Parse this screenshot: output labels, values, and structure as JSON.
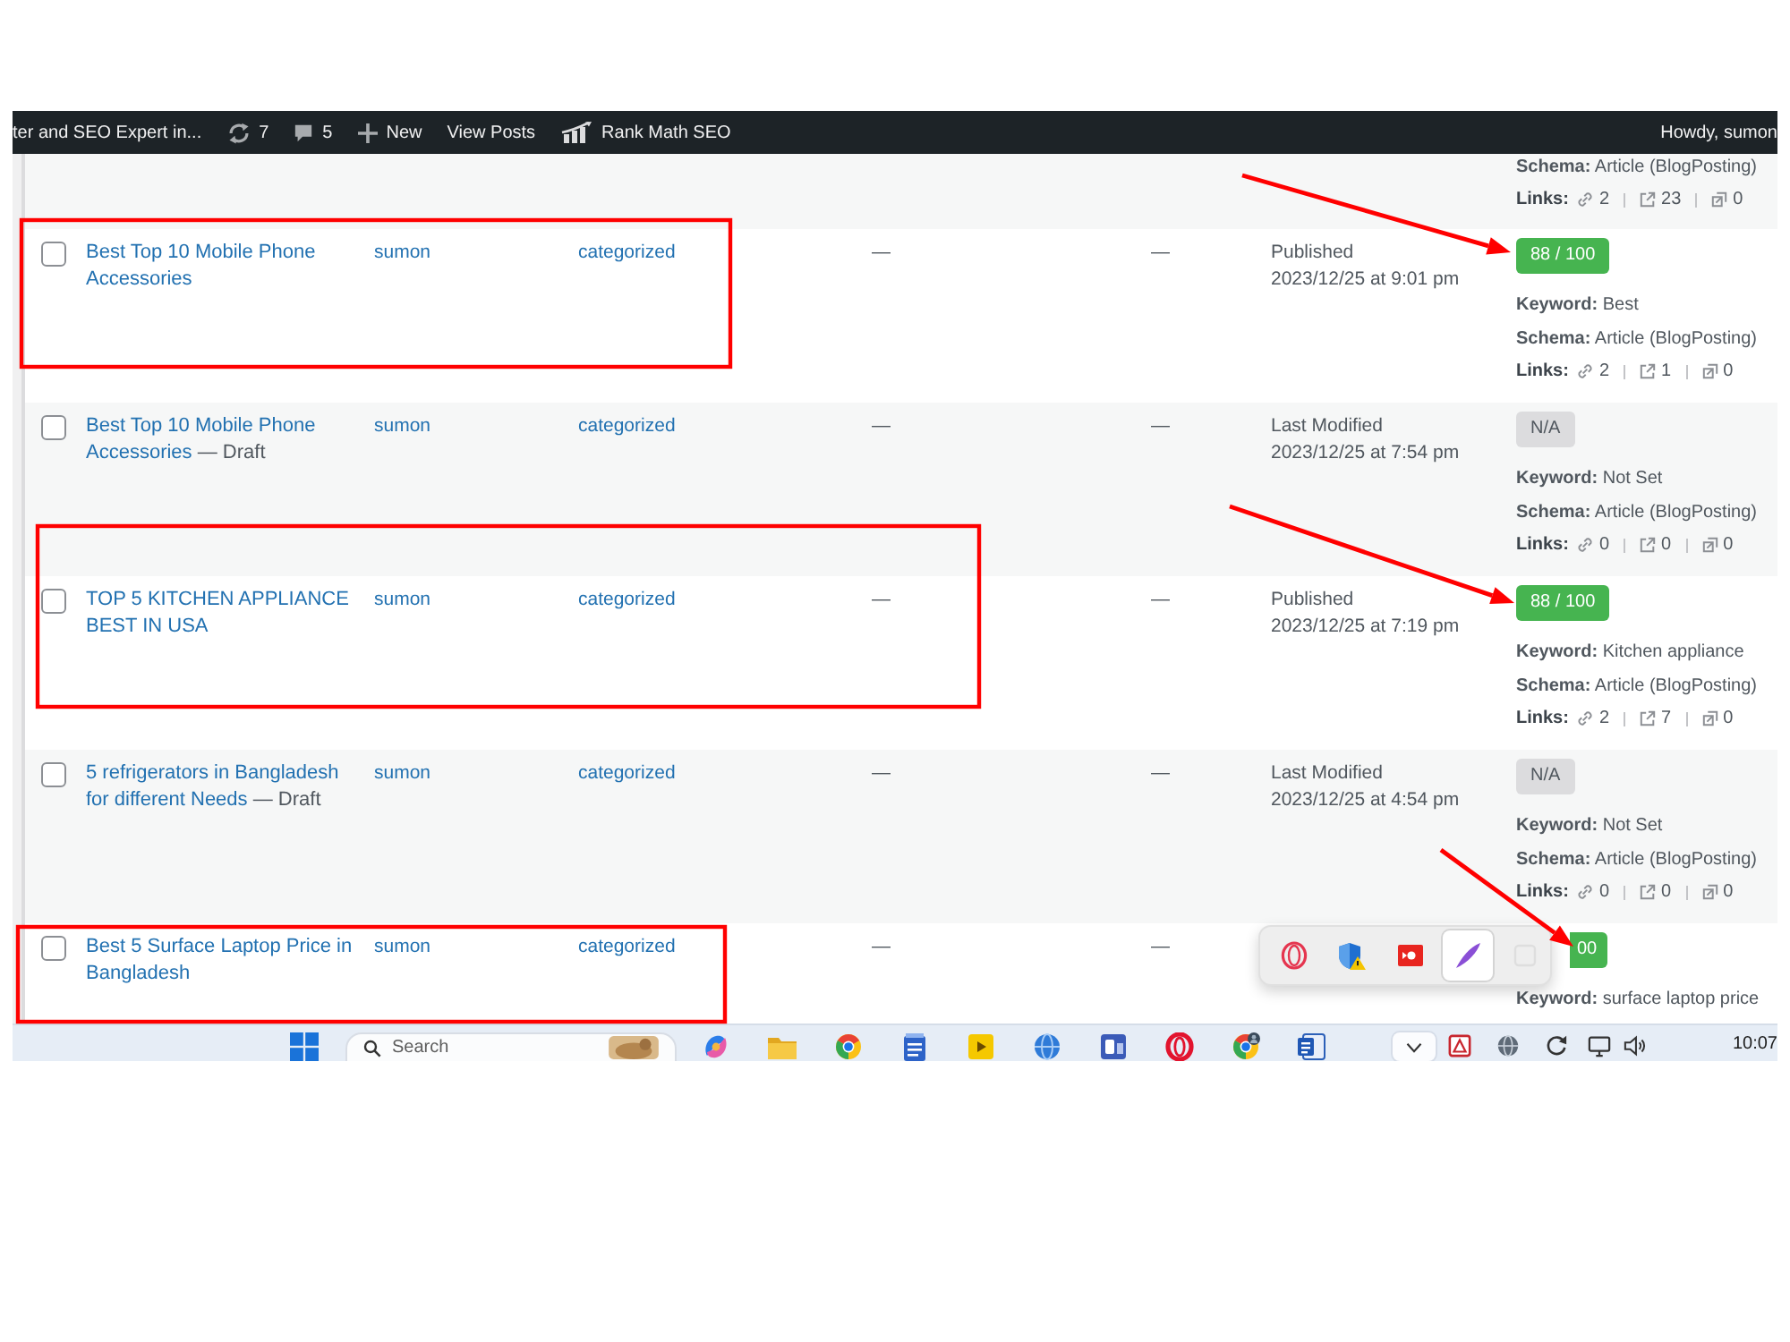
{
  "admin_bar": [
    {
      "kind": "site",
      "label": "ter and SEO Expert in..."
    },
    {
      "kind": "updates",
      "label": "7"
    },
    {
      "kind": "comments",
      "label": "5"
    },
    {
      "kind": "new",
      "label": "New"
    },
    {
      "kind": "link",
      "label": "View Posts"
    },
    {
      "kind": "seo",
      "label": "Rank Math SEO"
    },
    {
      "kind": "account",
      "label": "Howdy, sumon"
    }
  ],
  "previous_row_tail": {
    "schema": "**Schema:** Article (BlogPosting)",
    "links_label": "Links:",
    "links": [
      "2",
      "23",
      "0"
    ]
  },
  "rows": [
    {
      "checked": false,
      "title": "Best Top 10 Mobile Phone Accessories",
      "column_2": "sumon",
      "column_3": "categorized",
      "column_4": "—",
      "column_5": "—",
      "status": "Published",
      "date": "2023/12/25 at 9:01 pm",
      "score": {
        "kind": "good",
        "text": "88 / 100",
        "covered": false
      },
      "keyword": "**Keyword:** Best",
      "schema": "**Schema:** Article (BlogPosting)",
      "links_label": "Links:",
      "links": [
        "2",
        "1",
        "0"
      ]
    },
    {
      "checked": false,
      "title": "Best Top 10 Mobile Phone Accessories",
      "state": "— Draft",
      "column_2": "sumon",
      "column_3": "categorized",
      "column_4": "—",
      "column_5": "—",
      "status": "Last Modified",
      "date": "2023/12/25 at 7:54 pm",
      "score": {
        "kind": "none",
        "text": "N/A",
        "covered": false
      },
      "keyword": "**Keyword:** Not Set",
      "schema": "**Schema:** Article (BlogPosting)",
      "links_label": "Links:",
      "links": [
        "0",
        "0",
        "0"
      ]
    },
    {
      "checked": false,
      "title": "TOP 5 KITCHEN APPLIANCE BEST IN USA",
      "column_2": "sumon",
      "column_3": "categorized",
      "column_4": "—",
      "column_5": "—",
      "status": "Published",
      "date": "2023/12/25 at 7:19 pm",
      "score": {
        "kind": "good",
        "text": "88 / 100",
        "covered": false
      },
      "keyword": "**Keyword:** Kitchen appliance",
      "schema": "**Schema:** Article (BlogPosting)",
      "links_label": "Links:",
      "links": [
        "2",
        "7",
        "0"
      ]
    },
    {
      "checked": false,
      "title": "5 refrigerators in Bangladesh for different Needs",
      "state": "— Draft",
      "column_2": "sumon",
      "column_3": "categorized",
      "column_4": "—",
      "column_5": "—",
      "status": "Last Modified",
      "date": "2023/12/25 at 4:54 pm",
      "score": {
        "kind": "none",
        "text": "N/A",
        "covered": false
      },
      "keyword": "**Keyword:** Not Set",
      "schema": "**Schema:** Article (BlogPosting)",
      "links_label": "Links:",
      "links": [
        "0",
        "0",
        "0"
      ]
    },
    {
      "checked": false,
      "title": "Best 5 Surface Laptop Price in Bangladesh",
      "column_2": "sumon",
      "column_3": "categorized",
      "column_4": "—",
      "column_5": "—",
      "score": {
        "kind": "good",
        "text": "00",
        "covered": true
      },
      "keyword": "**Keyword:** surface laptop price"
    }
  ],
  "annotations": [
    {
      "kind": "arrow"
    },
    {
      "kind": "box"
    },
    {
      "kind": "arrow"
    },
    {
      "kind": "box"
    },
    {
      "kind": "arrow"
    },
    {
      "kind": "box"
    }
  ],
  "tray_flyout": {
    "items": [
      {
        "kind": "ring",
        "hovered": false
      },
      {
        "kind": "shield",
        "hovered": false
      },
      {
        "kind": "record",
        "hovered": false
      },
      {
        "kind": "feather",
        "hovered": true
      },
      {
        "kind": "blank",
        "hovered": false
      }
    ]
  },
  "taskbar": {
    "search": {
      "placeholder": "Search"
    },
    "tray_expanded": true,
    "clock": "10:07"
  }
}
